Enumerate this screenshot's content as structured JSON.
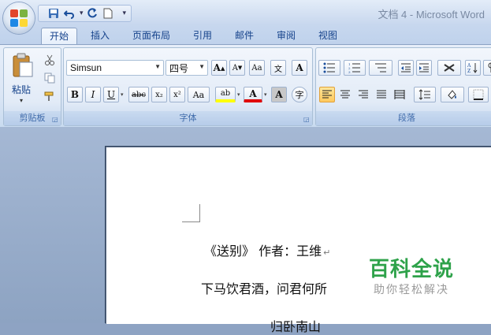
{
  "window": {
    "title": "文档 4 - Microsoft Word"
  },
  "quick_access": {
    "save_icon": "save-icon",
    "undo_icon": "undo-icon",
    "redo_icon": "repeat-icon",
    "new_icon": "new-document-icon",
    "customize_icon": "customize-qat-icon"
  },
  "tabs": [
    {
      "label": "开始",
      "active": true
    },
    {
      "label": "插入"
    },
    {
      "label": "页面布局"
    },
    {
      "label": "引用"
    },
    {
      "label": "邮件"
    },
    {
      "label": "审阅"
    },
    {
      "label": "视图"
    }
  ],
  "clipboard": {
    "group_label": "剪贴板",
    "paste_label": "粘贴",
    "cut_icon": "scissors-icon",
    "copy_icon": "copy-icon",
    "format_painter_icon": "format-painter-icon"
  },
  "font": {
    "group_label": "字体",
    "font_name": "Simsun",
    "font_size": "四号",
    "grow_label": "A",
    "shrink_label": "A",
    "clear_format_label": "Aa",
    "phonetic_label": "文",
    "char_border_label": "A",
    "bold_label": "B",
    "italic_label": "I",
    "underline_label": "U",
    "strikethrough_label": "abc",
    "subscript_label": "x₂",
    "superscript_label": "x²",
    "change_case_label": "Aa",
    "highlight_label": "ab",
    "font_color_label": "A",
    "char_shading_label": "A",
    "enclose_label": "字"
  },
  "paragraph": {
    "group_label": "段落",
    "active_alignment": "align-left"
  },
  "colors": {
    "highlight": "#ffff00",
    "font_color": "#e00000",
    "watermark_green": "#2ea24a"
  },
  "document": {
    "lines": [
      "《送别》 作者：王维",
      "下马饮君酒，问君何所",
      "归卧南山"
    ],
    "para_mark": "↵"
  },
  "watermark": {
    "title": "百科全说",
    "subtitle": "助你轻松解决"
  }
}
